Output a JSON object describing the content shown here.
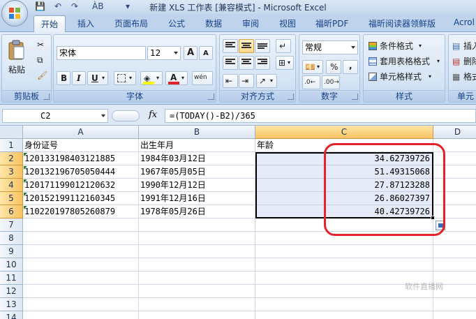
{
  "window": {
    "title": "新建 XLS 工作表  [兼容模式] - Microsoft Excel"
  },
  "tabs": [
    {
      "label": "开始",
      "active": true
    },
    {
      "label": "插入"
    },
    {
      "label": "页面布局"
    },
    {
      "label": "公式"
    },
    {
      "label": "数据"
    },
    {
      "label": "审阅"
    },
    {
      "label": "视图"
    },
    {
      "label": "福昕PDF"
    },
    {
      "label": "福昕阅读器领鲜版"
    },
    {
      "label": "Acrol"
    }
  ],
  "ribbon": {
    "clipboard": {
      "label": "剪贴板",
      "paste": "粘贴"
    },
    "font": {
      "label": "字体",
      "font_name": "宋体",
      "font_size": "12",
      "bold": "B",
      "italic": "I",
      "underline": "U",
      "font_color_glyph": "A",
      "grow": "A",
      "shrink": "A",
      "phonetic": "wén"
    },
    "alignment": {
      "label": "对齐方式"
    },
    "number": {
      "label": "数字",
      "format": "常规",
      "percent": "%",
      "comma": ","
    },
    "styles": {
      "label": "样式",
      "conditional": "条件格式",
      "table_format": "套用表格格式",
      "cell_styles": "单元格样式"
    },
    "cells": {
      "label": "单元",
      "insert": "插入",
      "delete": "删除",
      "format": "格式"
    }
  },
  "formula_bar": {
    "name_box": "C2",
    "fx": "fx",
    "formula": "=(TODAY()-B2)/365"
  },
  "grid": {
    "columns": [
      "A",
      "B",
      "C",
      "D"
    ],
    "selected_column": "C",
    "rows": [
      "1",
      "2",
      "3",
      "4",
      "5",
      "6",
      "7",
      "8",
      "9",
      "10",
      "11",
      "12",
      "13",
      "14"
    ],
    "selected_rows": [
      "2",
      "3",
      "4",
      "5",
      "6"
    ],
    "header_row": {
      "a": "身份证号",
      "b": "出生年月",
      "c": "年龄"
    },
    "data_rows": [
      {
        "a": "120133198403121885",
        "b": "1984年03月12日",
        "c": "34.62739726"
      },
      {
        "a": "120132196705050444",
        "b": "1967年05月05日",
        "c": "51.49315068"
      },
      {
        "a": "120171199012120632",
        "b": "1990年12月12日",
        "c": "27.87123288"
      },
      {
        "a": "120152199112160345",
        "b": "1991年12月16日",
        "c": "26.86027397"
      },
      {
        "a": "110220197805260879",
        "b": "1978年05月26日",
        "c": "40.42739726"
      }
    ]
  },
  "watermark": "软件直播网"
}
